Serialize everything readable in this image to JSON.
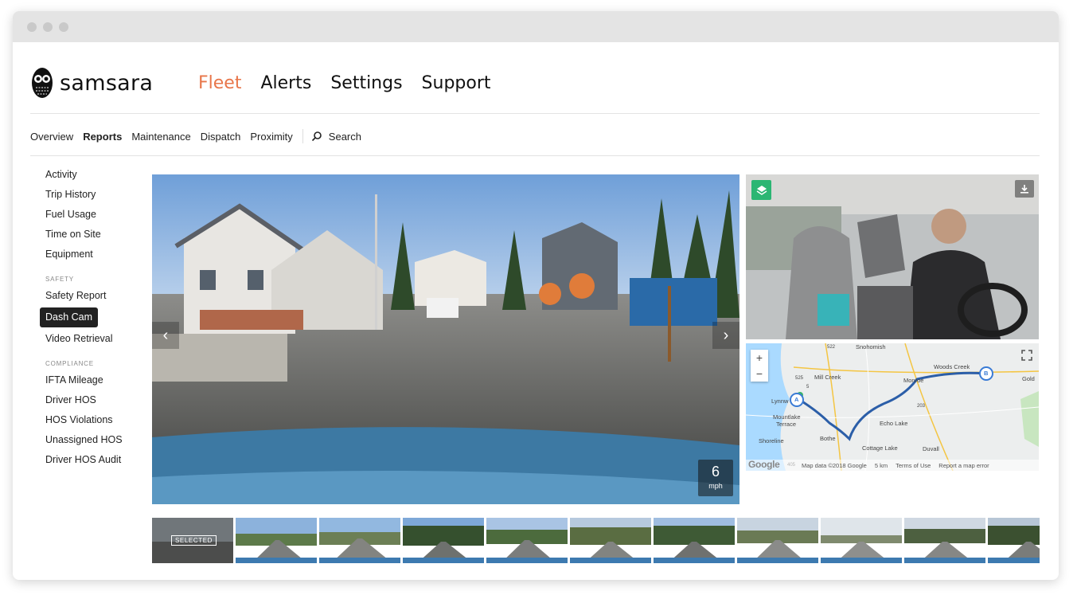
{
  "app": {
    "brand": "samsara"
  },
  "topnav": [
    {
      "label": "Fleet",
      "active": true
    },
    {
      "label": "Alerts"
    },
    {
      "label": "Settings"
    },
    {
      "label": "Support"
    }
  ],
  "subnav": {
    "items": [
      {
        "label": "Overview"
      },
      {
        "label": "Reports",
        "active": true
      },
      {
        "label": "Maintenance"
      },
      {
        "label": "Dispatch"
      },
      {
        "label": "Proximity"
      }
    ],
    "search_placeholder": "Search"
  },
  "sidebar": {
    "items": [
      {
        "label": "Activity"
      },
      {
        "label": "Trip History"
      },
      {
        "label": "Fuel Usage"
      },
      {
        "label": "Time on Site"
      },
      {
        "label": "Equipment"
      }
    ],
    "safety_heading": "SAFETY",
    "safety_items": [
      {
        "label": "Safety Report"
      },
      {
        "label": "Dash Cam",
        "active": true
      },
      {
        "label": "Video Retrieval"
      }
    ],
    "compliance_heading": "COMPLIANCE",
    "compliance_items": [
      {
        "label": "IFTA Mileage"
      },
      {
        "label": "Driver HOS"
      },
      {
        "label": "HOS Violations"
      },
      {
        "label": "Unassigned HOS"
      },
      {
        "label": "Driver HOS Audit"
      }
    ]
  },
  "video": {
    "speed_value": "6",
    "speed_unit": "mph"
  },
  "map": {
    "labels": {
      "snohomish": "Snohomish",
      "mill_creek": "Mill Creek",
      "woods_creek": "Woods Creek",
      "monroe": "Monroe",
      "gold": "Gold",
      "lynnwood": "Lynnw",
      "mountlake": "Mountlake",
      "terrace": "Terrace",
      "echo_lake": "Echo Lake",
      "shoreline": "Shoreline",
      "bothell": "Bothe",
      "cottage_lake": "Cottage Lake",
      "duvall": "Duvall",
      "marker_a": "A",
      "marker_b": "B",
      "route_522": "522",
      "route_203": "203",
      "route_525": "525",
      "route_5": "5",
      "route_405": "405"
    },
    "footer": {
      "google": "Google",
      "data": "Map data ©2018 Google",
      "scale": "5 km",
      "terms": "Terms of Use",
      "report": "Report a map error"
    }
  },
  "thumbnails": {
    "selected_label": "SELECTED",
    "count": 11
  },
  "colors": {
    "accent": "#e8764a",
    "layers_button": "#2bb673",
    "route": "#2b5ea8"
  }
}
